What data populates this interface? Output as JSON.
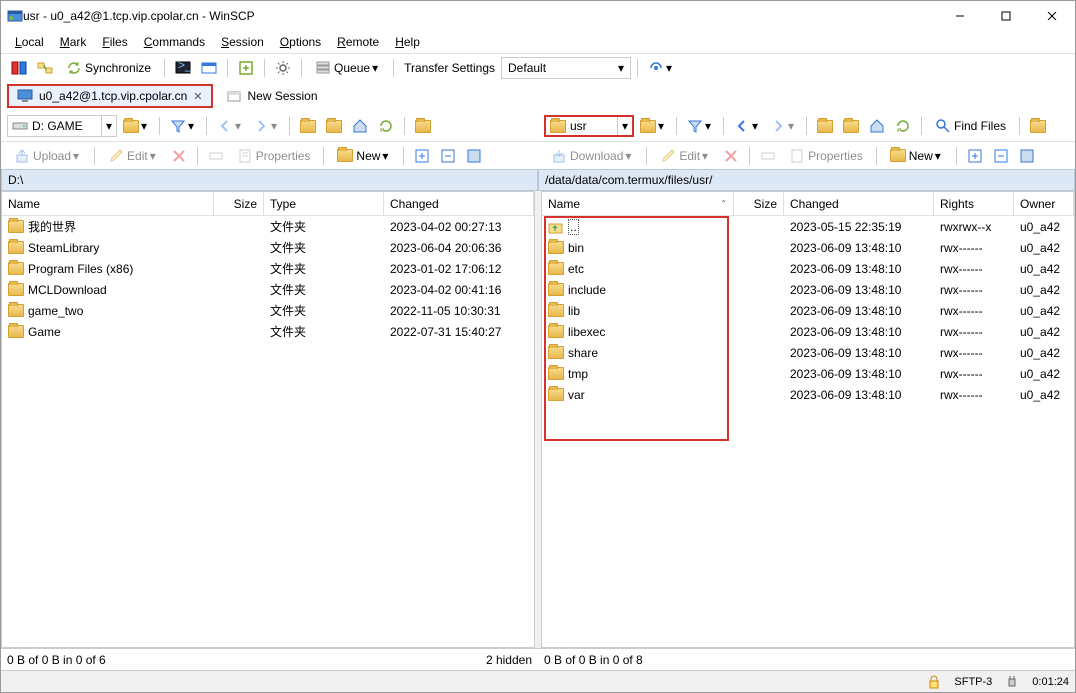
{
  "window": {
    "title": "usr - u0_a42@1.tcp.vip.cpolar.cn - WinSCP"
  },
  "menu": {
    "local": "Local",
    "mark": "Mark",
    "files": "Files",
    "commands": "Commands",
    "session": "Session",
    "options": "Options",
    "remote": "Remote",
    "help": "Help"
  },
  "toolbar1": {
    "sync": "Synchronize",
    "queue": "Queue",
    "transfer_label": "Transfer Settings",
    "transfer_value": "Default"
  },
  "session_tab": {
    "label": "u0_a42@1.tcp.vip.cpolar.cn",
    "new": "New Session"
  },
  "local": {
    "drive": "D: GAME",
    "find": "Find Files",
    "path": "D:\\",
    "upload": "Upload",
    "edit": "Edit",
    "properties": "Properties",
    "new": "New",
    "cols": {
      "name": "Name",
      "size": "Size",
      "type": "Type",
      "changed": "Changed"
    },
    "rows": [
      {
        "name": "我的世界",
        "type": "文件夹",
        "changed": "2023-04-02  00:27:13"
      },
      {
        "name": "SteamLibrary",
        "type": "文件夹",
        "changed": "2023-06-04  20:06:36"
      },
      {
        "name": "Program Files (x86)",
        "type": "文件夹",
        "changed": "2023-01-02  17:06:12"
      },
      {
        "name": "MCLDownload",
        "type": "文件夹",
        "changed": "2023-04-02  00:41:16"
      },
      {
        "name": "game_two",
        "type": "文件夹",
        "changed": "2022-11-05  10:30:31"
      },
      {
        "name": "Game",
        "type": "文件夹",
        "changed": "2022-07-31  15:40:27"
      }
    ],
    "status": "0 B of 0 B in 0 of 6",
    "hidden": "2 hidden"
  },
  "remote": {
    "drive": "usr",
    "find": "Find Files",
    "path": "/data/data/com.termux/files/usr/",
    "download": "Download",
    "edit": "Edit",
    "properties": "Properties",
    "new": "New",
    "cols": {
      "name": "Name",
      "size": "Size",
      "changed": "Changed",
      "rights": "Rights",
      "owner": "Owner"
    },
    "rows": [
      {
        "name": "..",
        "up": true,
        "changed": "2023-05-15 22:35:19",
        "rights": "rwxrwx--x",
        "owner": "u0_a42"
      },
      {
        "name": "bin",
        "changed": "2023-06-09 13:48:10",
        "rights": "rwx------",
        "owner": "u0_a42"
      },
      {
        "name": "etc",
        "changed": "2023-06-09 13:48:10",
        "rights": "rwx------",
        "owner": "u0_a42"
      },
      {
        "name": "include",
        "changed": "2023-06-09 13:48:10",
        "rights": "rwx------",
        "owner": "u0_a42"
      },
      {
        "name": "lib",
        "changed": "2023-06-09 13:48:10",
        "rights": "rwx------",
        "owner": "u0_a42"
      },
      {
        "name": "libexec",
        "changed": "2023-06-09 13:48:10",
        "rights": "rwx------",
        "owner": "u0_a42"
      },
      {
        "name": "share",
        "changed": "2023-06-09 13:48:10",
        "rights": "rwx------",
        "owner": "u0_a42"
      },
      {
        "name": "tmp",
        "changed": "2023-06-09 13:48:10",
        "rights": "rwx------",
        "owner": "u0_a42"
      },
      {
        "name": "var",
        "changed": "2023-06-09 13:48:10",
        "rights": "rwx------",
        "owner": "u0_a42"
      }
    ],
    "status": "0 B of 0 B in 0 of 8"
  },
  "bottom": {
    "protocol": "SFTP-3",
    "time": "0:01:24"
  }
}
